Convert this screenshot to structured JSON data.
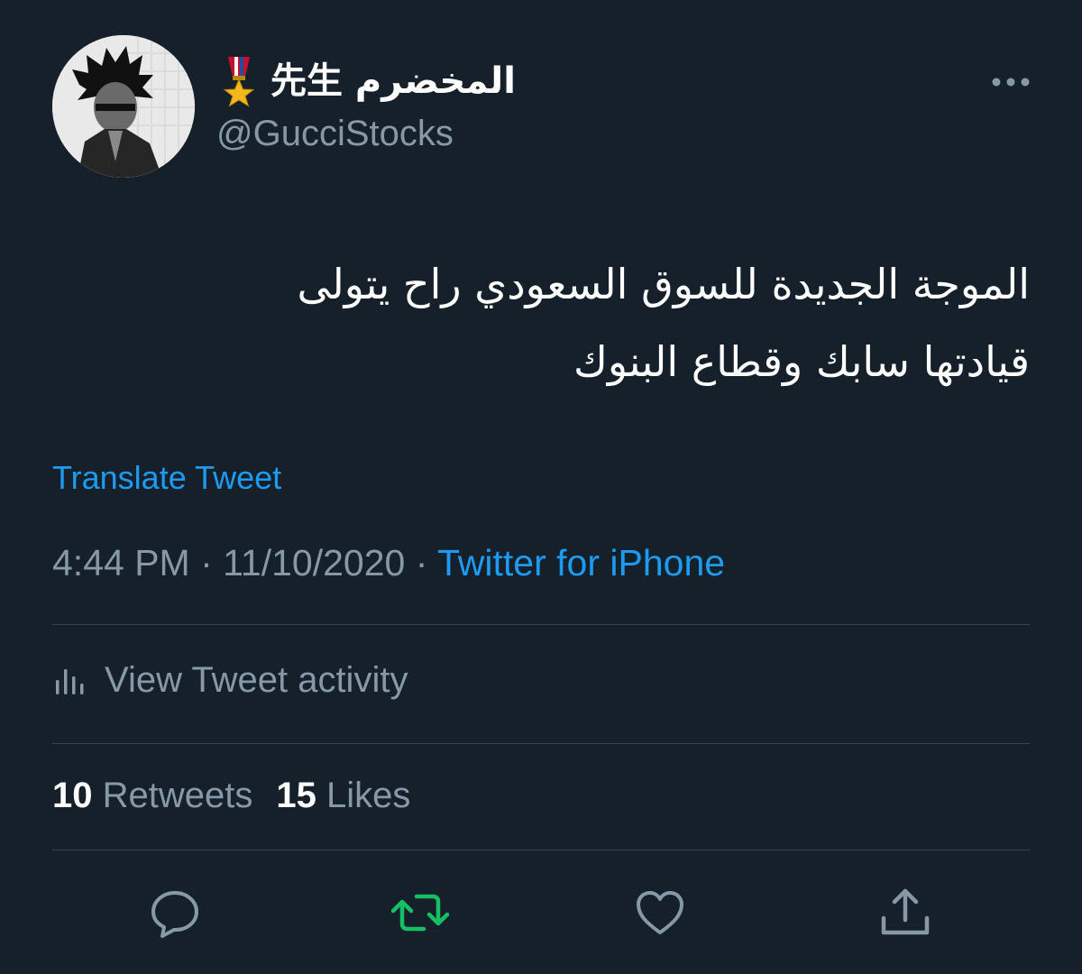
{
  "user": {
    "display_name": "المخضرم 先生",
    "handle": "@GucciStocks",
    "avatar_icon": "avatar-photo",
    "badge_icon": "military-medal-icon"
  },
  "tweet": {
    "text_line1": "الموجة الجديدة للسوق السعودي راح يتولى",
    "text_line2": "قيادتها سابك وقطاع البنوك",
    "translate_label": "Translate Tweet",
    "time": "4:44 PM",
    "date": "11/10/2020",
    "separator": " · ",
    "source": "Twitter for iPhone"
  },
  "activity": {
    "icon": "bar-chart-icon",
    "label": "View Tweet activity"
  },
  "stats": {
    "retweets_count": "10",
    "retweets_label": "Retweets",
    "likes_count": "15",
    "likes_label": "Likes"
  },
  "actions": {
    "reply_icon": "speech-bubble-icon",
    "retweet_icon": "retweet-arrows-icon",
    "like_icon": "heart-icon",
    "share_icon": "share-upload-icon"
  },
  "colors": {
    "background": "#15202b",
    "primary_text": "#ffffff",
    "secondary_text": "#8899a6",
    "accent_blue": "#1d9bf0",
    "retweet_green": "#17bf63",
    "divider": "#38444d"
  }
}
